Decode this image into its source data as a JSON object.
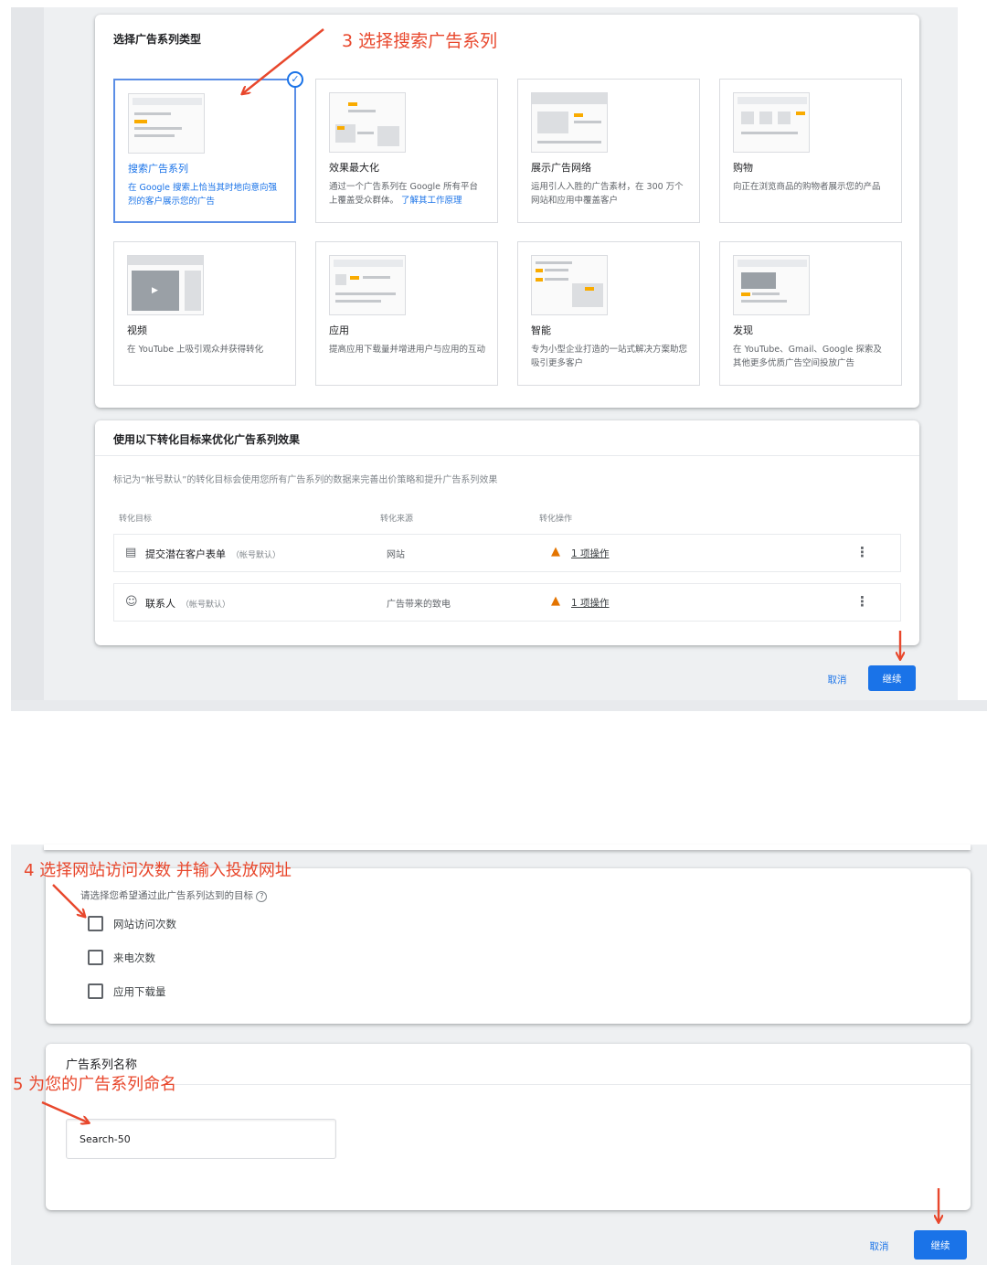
{
  "top": {
    "type_card": {
      "title": "选择广告系列类型",
      "tiles": [
        {
          "title": "搜索广告系列",
          "desc": "在 Google 搜索上恰当其时地向意向强烈的客户展示您的广告",
          "selected": true
        },
        {
          "title": "效果最大化",
          "desc": "通过一个广告系列在 Google 所有平台上覆盖受众群体。",
          "link": "了解其工作原理"
        },
        {
          "title": "展示广告网络",
          "desc": "运用引人入胜的广告素材，在 300 万个网站和应用中覆盖客户"
        },
        {
          "title": "购物",
          "desc": "向正在浏览商品的购物者展示您的产品"
        },
        {
          "title": "视频",
          "desc": "在 YouTube 上吸引观众并获得转化"
        },
        {
          "title": "应用",
          "desc": "提高应用下载量并增进用户与应用的互动"
        },
        {
          "title": "智能",
          "desc": "专为小型企业打造的一站式解决方案助您吸引更多客户"
        },
        {
          "title": "发现",
          "desc": "在 YouTube、Gmail、Google 探索及其他更多优质广告空间投放广告"
        }
      ]
    },
    "goal_card": {
      "title": "使用以下转化目标来优化广告系列效果",
      "subtitle": "标记为“帐号默认”的转化目标会使用您所有广告系列的数据来完善出价策略和提升广告系列效果",
      "columns": [
        "转化目标",
        "转化来源",
        "转化操作"
      ],
      "rows": [
        {
          "icon": "form-icon",
          "name": "提交潜在客户表单",
          "default": "（帐号默认）",
          "source": "网站",
          "action": "1 项操作"
        },
        {
          "icon": "contact-icon",
          "name": "联系人",
          "default": "（帐号默认）",
          "source": "广告带来的致电",
          "action": "1 项操作"
        }
      ]
    },
    "cancel": "取消",
    "continue": "继续"
  },
  "bottom": {
    "goals": {
      "prompt": "请选择您希望通过此广告系列达到的目标",
      "options": [
        "网站访问次数",
        "来电次数",
        "应用下载量"
      ]
    },
    "name_card": {
      "label": "广告系列名称",
      "value": "Search-50"
    },
    "cancel": "取消",
    "continue": "继续"
  },
  "annotations": {
    "a3": "3 选择搜索广告系列",
    "a4": "4 选择网站访问次数 并输入投放网址",
    "a5": "5 为您的广告系列命名"
  },
  "colors": {
    "accent": "#1a73e8",
    "annotation": "#e8472c",
    "warning": "#e37400"
  }
}
